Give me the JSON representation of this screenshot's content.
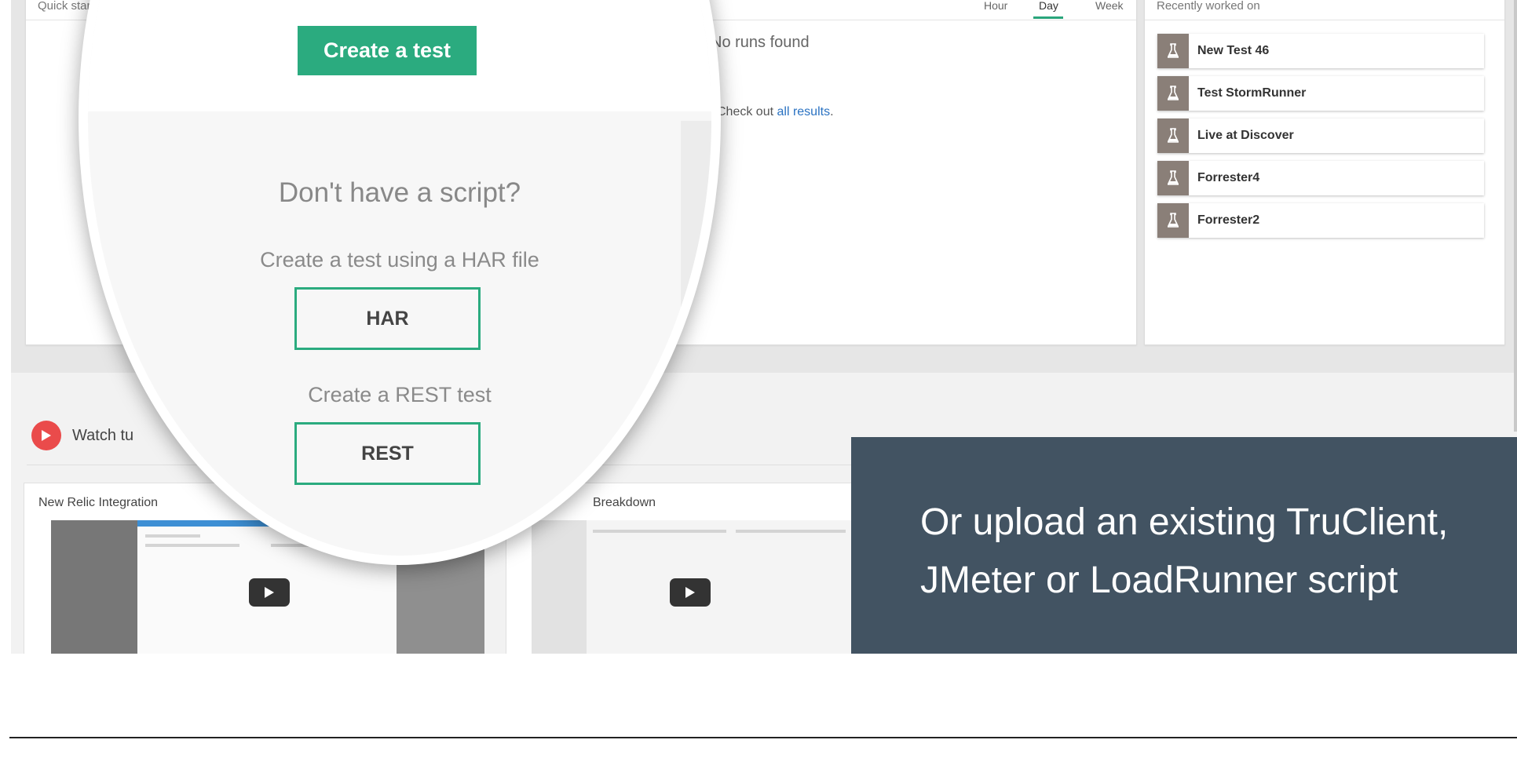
{
  "quick_start": {
    "title": "Quick start",
    "range_tabs": [
      {
        "label": "Hour",
        "active": false
      },
      {
        "label": "Day",
        "active": true
      },
      {
        "label": "Week",
        "active": false
      }
    ],
    "no_runs": "No runs found",
    "check_out_prefix": "Check out ",
    "check_out_link": "all results",
    "check_out_suffix": "."
  },
  "recent": {
    "title": "Recently worked on",
    "icon": "flask-icon",
    "items": [
      {
        "label": "New Test 46"
      },
      {
        "label": "Test StormRunner"
      },
      {
        "label": "Live at Discover"
      },
      {
        "label": "Forrester4"
      },
      {
        "label": "Forrester2"
      }
    ]
  },
  "magnifier": {
    "create_test": "Create a test",
    "no_script_title": "Don't have a script?",
    "har_caption": "Create a test using a HAR file",
    "har_button": "HAR",
    "rest_caption": "Create a REST test",
    "rest_button": "REST"
  },
  "tutorials": {
    "watch_label": "Watch tu",
    "videos": [
      {
        "title": "New Relic Integration"
      },
      {
        "title": "Breakdown"
      }
    ]
  },
  "callout": {
    "text": "Or upload an existing TruClient, JMeter or LoadRunner script"
  },
  "colors": {
    "accent": "#2bab7f",
    "callout_bg": "#425362",
    "play_red": "#ea4b4b",
    "link": "#2a72c2"
  }
}
